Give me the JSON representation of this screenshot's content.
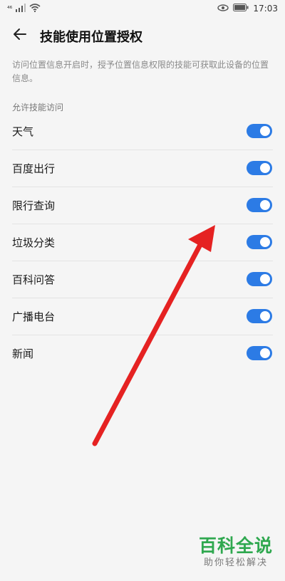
{
  "status_bar": {
    "signal_label": "⁴⁶",
    "time": "17:03",
    "icons": [
      "signal-icon",
      "wifi-icon",
      "eye-icon",
      "battery-icon"
    ]
  },
  "header": {
    "title": "技能使用位置授权",
    "back_icon": "back-arrow-icon"
  },
  "description": "访问位置信息开启时，授予位置信息权限的技能可获取此设备的位置信息。",
  "section": {
    "title": "允许技能访问"
  },
  "skills": [
    {
      "label": "天气",
      "enabled": true
    },
    {
      "label": "百度出行",
      "enabled": true
    },
    {
      "label": "限行查询",
      "enabled": true
    },
    {
      "label": "垃圾分类",
      "enabled": true
    },
    {
      "label": "百科问答",
      "enabled": true
    },
    {
      "label": "广播电台",
      "enabled": true
    },
    {
      "label": "新闻",
      "enabled": true
    }
  ],
  "annotation": {
    "icon": "red-arrow-annotation",
    "color": "#e52222"
  },
  "watermark": {
    "main": "百科全说",
    "sub": "助你轻松解决"
  },
  "colors": {
    "toggle_on": "#2c7be5",
    "background": "#f5f5f5",
    "watermark_green": "#2fa84f"
  }
}
